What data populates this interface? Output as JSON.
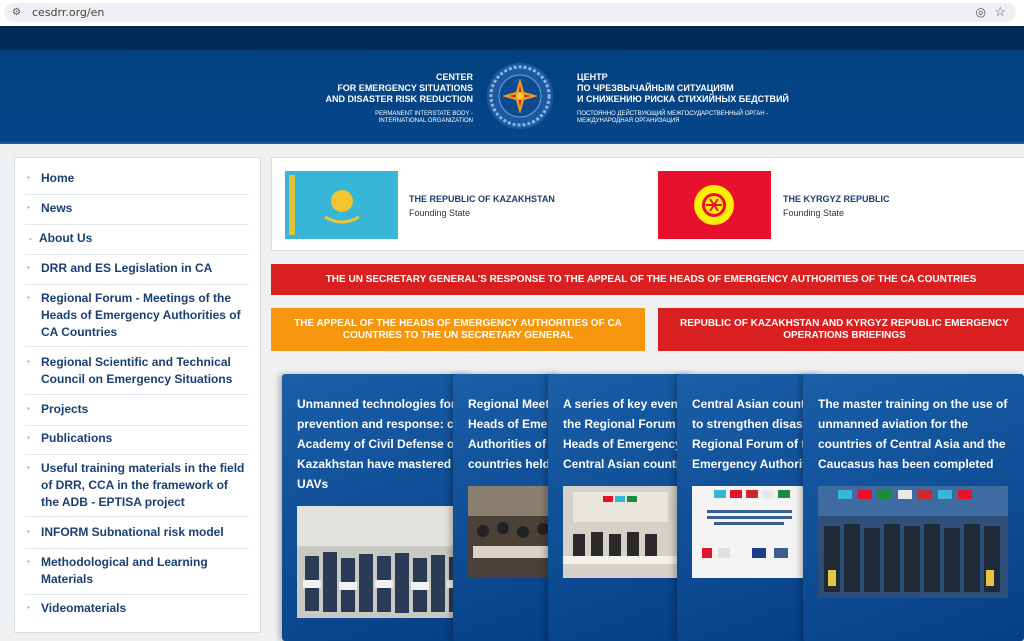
{
  "browser": {
    "url": "cesdrr.org/en"
  },
  "header": {
    "en_title_lines": [
      "CENTER",
      "FOR EMERGENCY SITUATIONS",
      "AND DISASTER RISK REDUCTION"
    ],
    "en_sub_lines": [
      "PERMANENT INTERSTATE BODY -",
      "INTERNATIONAL ORGANIZATION"
    ],
    "ru_title_lines": [
      "ЦЕНТР",
      "ПО ЧРЕЗВЫЧАЙНЫМ СИТУАЦИЯМ",
      "И СНИЖЕНИЮ РИСКА СТИХИЙНЫХ БЕДСТВИЙ"
    ],
    "ru_sub_lines": [
      "ПОСТОЯННО ДЕЙСТВУЮЩИЙ МЕЖГОСУДАРСТВЕННЫЙ ОРГАН -",
      "МЕЖДУНАРОДНАЯ ОРГАНИЗАЦИЯ"
    ]
  },
  "sidebar": {
    "items": [
      {
        "label": "Home",
        "bullet": "•"
      },
      {
        "label": "News",
        "bullet": "•"
      },
      {
        "label": "About Us",
        "bullet": "⌄"
      },
      {
        "label": "DRR and ES Legislation in CA",
        "bullet": "•"
      },
      {
        "label": "Regional Forum - Meetings of the Heads of Emergency Authorities of CA Countries",
        "bullet": "•"
      },
      {
        "label": "Regional Scientific and Technical Council on Emergency Situations",
        "bullet": "•"
      },
      {
        "label": "Projects",
        "bullet": "•"
      },
      {
        "label": "Publications",
        "bullet": "•"
      },
      {
        "label": "Useful training materials in the field of DRR, CCA in the framework of the ADB - EPTISA project",
        "bullet": "•"
      },
      {
        "label": "INFORM Subnational risk model",
        "bullet": "•"
      },
      {
        "label": "Methodological and Learning Materials",
        "bullet": "•"
      },
      {
        "label": "Videomaterials",
        "bullet": "•"
      }
    ]
  },
  "states": [
    {
      "name": "THE REPUBLIC OF KAZAKHSTAN",
      "subtitle": "Founding State"
    },
    {
      "name": "THE KYRGYZ REPUBLIC",
      "subtitle": "Founding State"
    }
  ],
  "banners": {
    "un_response": "THE UN SECRETARY GENERAL'S RESPONSE TO THE APPEAL OF THE HEADS OF EMERGENCY AUTHORITIES OF THE CA COUNTRIES",
    "appeal": "THE APPEAL OF THE HEADS OF EMERGENCY AUTHORITIES OF CA COUNTRIES TO THE UN SECRETARY GENERAL",
    "briefings": "REPUBLIC OF KAZAKHSTAN AND KYRGYZ REPUBLIC EMERGENCY OPERATIONS BRIEFINGS"
  },
  "news_cards": [
    {
      "lines": [
        "Unmanned technologies for d",
        "prevention and response: ca",
        "Academy of Civil Defense of",
        "Kazakhstan have mastered w",
        "UAVs"
      ]
    },
    {
      "lines": [
        "Regional Meeti",
        "Heads of Emer",
        "Authorities of C",
        "countries held"
      ]
    },
    {
      "lines": [
        "A series of key events",
        "the Regional Forum –",
        "Heads of Emergency",
        "Central Asian countri"
      ]
    },
    {
      "lines": [
        "Central Asian countr",
        "to strengthen disaste",
        "Regional Forum of th",
        "Emergency Authoriti"
      ]
    },
    {
      "lines": [
        "The master training on the use of",
        "unmanned aviation for the",
        "countries of Central Asia and the",
        "Caucasus has been completed"
      ]
    }
  ],
  "colors": {
    "accent": "#1a3f73",
    "banner_red": "#d91f1f",
    "banner_orange": "#f5960c",
    "header_blue": "#03427f"
  }
}
